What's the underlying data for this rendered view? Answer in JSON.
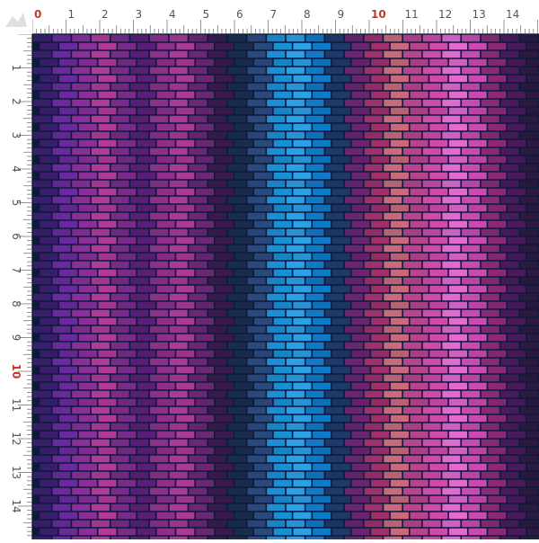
{
  "ruler": {
    "unit_labels": [
      "0",
      "1",
      "2",
      "3",
      "4",
      "5",
      "6",
      "7",
      "8",
      "9",
      "10",
      "11",
      "12",
      "13",
      "14"
    ],
    "major_label_color": "#c0392b",
    "minor_label_color": "#555555",
    "tick_color": "#666666",
    "major_labels": [
      "0",
      "10"
    ]
  },
  "fabric": {
    "grout_color": "#0e1a3a",
    "stripe_colors": [
      "#3a1e6e",
      "#6a2a9e",
      "#8a2f9a",
      "#b03a98",
      "#7a2a88",
      "#5a1e76",
      "#8e2f8c",
      "#a93a96",
      "#6c2672",
      "#3a1a4e",
      "#1a2c4c",
      "#2a4a7e",
      "#1b8fd6",
      "#2ba0e6",
      "#0f7ac8",
      "#1d3a6a",
      "#6a2470",
      "#a0306a",
      "#c86a7a",
      "#b8448e",
      "#d04aa8",
      "#e06ad0",
      "#c94ab0",
      "#8a2a76",
      "#4a1a5c",
      "#2a1a3e"
    ]
  }
}
